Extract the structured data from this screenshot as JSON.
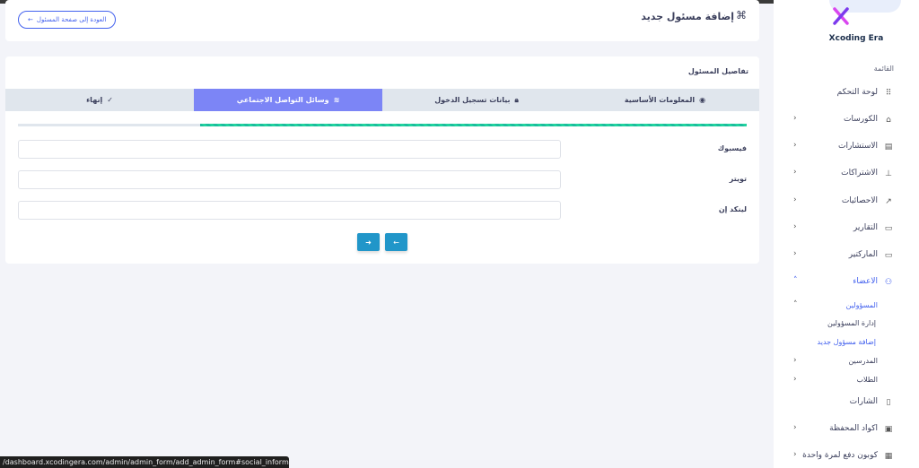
{
  "sidebar": {
    "brand_name": "Xcoding Era",
    "menu_heading": "القائمة",
    "items": [
      {
        "label": "لوحة التحكم",
        "icon": "grid-icon",
        "glyph": "⠿",
        "chevron": false,
        "active": false
      },
      {
        "label": "الكورسات",
        "icon": "cube-icon",
        "glyph": "⌂",
        "chevron": true,
        "active": false
      },
      {
        "label": "الاستشارات",
        "icon": "file-icon",
        "glyph": "▤",
        "chevron": true,
        "active": false
      },
      {
        "label": "الاشتراكات",
        "icon": "sitemap-icon",
        "glyph": "⊥",
        "chevron": true,
        "active": false
      },
      {
        "label": "الاحصائيات",
        "icon": "trend-icon",
        "glyph": "↗",
        "chevron": true,
        "active": false
      },
      {
        "label": "التقارير",
        "icon": "archive-icon",
        "glyph": "▭",
        "chevron": true,
        "active": false
      },
      {
        "label": "الماركتير",
        "icon": "archive-icon",
        "glyph": "▭",
        "chevron": true,
        "active": false
      },
      {
        "label": "الاعضاء",
        "icon": "users-icon",
        "glyph": "⚇",
        "chevron": true,
        "active": true
      }
    ],
    "members_sub": [
      {
        "label": "المسؤولين",
        "chevron": true,
        "active": true
      },
      {
        "label": "إدارة المسؤولين",
        "level": 2,
        "active": false
      },
      {
        "label": "إضافة مسؤول جديد",
        "level": 2,
        "active": true
      },
      {
        "label": "المدرسين",
        "chevron": true,
        "active": false
      },
      {
        "label": "الطلاب",
        "chevron": true,
        "active": false
      }
    ],
    "bottom_items": [
      {
        "label": "الشارات",
        "icon": "bookmark-icon",
        "glyph": "▯",
        "chevron": false
      },
      {
        "label": "اكواد المحفظة",
        "icon": "wallet-icon",
        "glyph": "▣",
        "chevron": true
      },
      {
        "label": "كوبون دفع لمرة واحدة",
        "icon": "coupon-icon",
        "glyph": "▦",
        "chevron": true
      }
    ]
  },
  "header": {
    "title": "إضافة مسئول جديد",
    "command_icon": "⌘",
    "back_button": "العودة إلى صفحة المسئول",
    "back_arrow": "←"
  },
  "form": {
    "section_title": "تفاصيل المسئول",
    "steps": [
      {
        "label": "المعلومات الأساسية",
        "icon": "info-icon",
        "glyph": "◉",
        "active": false
      },
      {
        "label": "بيانات تسجيل الدخول",
        "icon": "lock-icon",
        "glyph": "🔒︎",
        "active": false
      },
      {
        "label": "وسائل التواصل الاجتماعي",
        "icon": "wifi-icon",
        "glyph": "≋",
        "active": true
      },
      {
        "label": "إنهاء",
        "icon": "check-circle-icon",
        "glyph": "✓",
        "active": false
      }
    ],
    "progress": 0.75,
    "fields": [
      {
        "label": "فيسبوك",
        "value": "",
        "placeholder": ""
      },
      {
        "label": "تويتر",
        "value": "",
        "placeholder": ""
      },
      {
        "label": "لينكد إن",
        "value": "",
        "placeholder": ""
      }
    ],
    "next_glyph": "➜",
    "prev_glyph": "←"
  },
  "status_url": "/dashboard.xcodingera.com/admin/admin_form/add_admin_form#social_information",
  "colors": {
    "primary": "#4361ee",
    "step_active": "#7c85f6",
    "progress": "#1abc9c",
    "nav_button": "#2196c9"
  }
}
